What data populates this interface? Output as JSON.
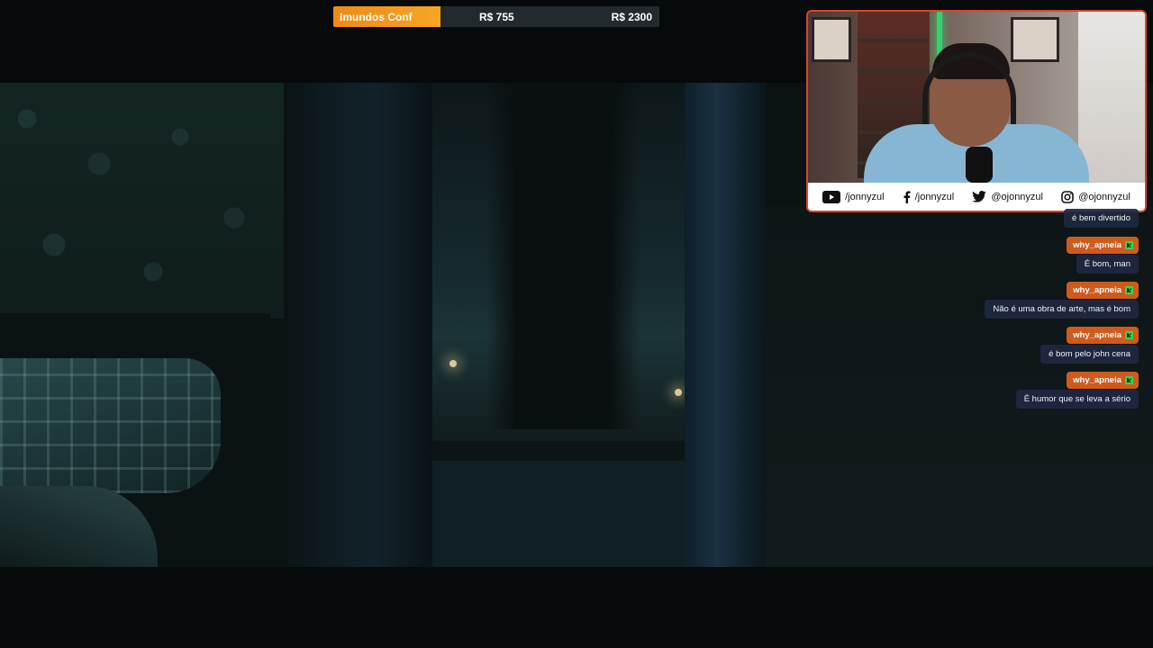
{
  "goal_bar": {
    "label": "Imundos Conf",
    "current": "R$ 755",
    "target": "R$ 2300",
    "progress_fraction": 0.328,
    "fill_color": "#f39c1d"
  },
  "webcam": {
    "border_color": "#e0412b",
    "socials": [
      {
        "icon": "youtube-icon",
        "handle": "/jonnyzul"
      },
      {
        "icon": "facebook-icon",
        "handle": "/jonnyzul"
      },
      {
        "icon": "twitter-icon",
        "handle": "@ojonnyzul"
      },
      {
        "icon": "instagram-icon",
        "handle": "@ojonnyzul"
      }
    ]
  },
  "chat": {
    "name_tag_color": "#d05a1c",
    "badge_color": "#3bd14f",
    "messages": [
      {
        "user": "",
        "text": "é bem divertido"
      },
      {
        "user": "why_apneia",
        "text": "É bom, man"
      },
      {
        "user": "why_apneia",
        "text": "Não é uma obra de arte, mas é bom"
      },
      {
        "user": "why_apneia",
        "text": "é bom pelo john cena"
      },
      {
        "user": "why_apneia",
        "text": "É humor que se leva a sério"
      }
    ]
  }
}
